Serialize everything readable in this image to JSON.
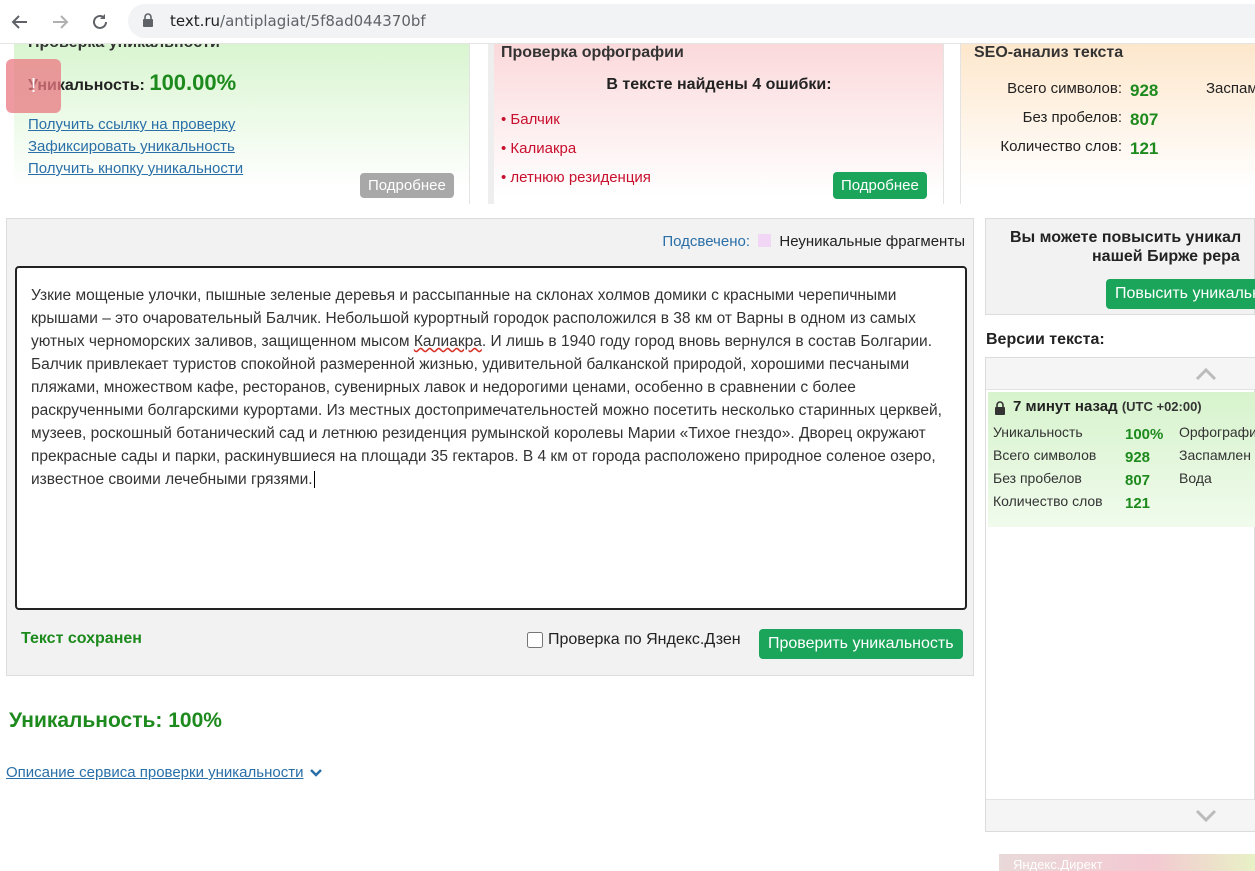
{
  "browser": {
    "url_host": "text.ru",
    "url_path": "/antiplagiat/5f8ad044370bf"
  },
  "uniqueness_panel": {
    "title": "Проверка уникальности",
    "label": "Уникальность:",
    "value": "100.00%",
    "links": [
      "Получить ссылку на проверку",
      "Зафиксировать уникальность",
      "Получить кнопку уникальности"
    ],
    "more_button": "Подробнее",
    "badge_glyph": "!"
  },
  "spelling_panel": {
    "title": "Проверка орфографии",
    "subtitle": "В тексте найдены 4 ошибки:",
    "errors": [
      "Балчик",
      "Калиакра",
      "летнюю резиденция"
    ],
    "more_button": "Подробнее"
  },
  "seo_panel": {
    "title": "SEO-анализ текста",
    "rows": [
      {
        "label": "Всего символов:",
        "value": "928"
      },
      {
        "label": "Без пробелов:",
        "value": "807"
      },
      {
        "label": "Количество слов:",
        "value": "121"
      }
    ],
    "cut_label": "Заспам"
  },
  "editor": {
    "highlight_label": "Подсвечено:",
    "highlight_desc": "Неуникальные фрагменты",
    "text_before": "Узкие мощеные улочки, пышные зеленые деревья и рассыпанные на склонах холмов домики с красными черепичными крышами – это очаровательный Балчик. Небольшой курортный городок расположился в 38 км от Варны в одном из самых уютных черноморских заливов, защищенном мысом ",
    "text_underlined": "Калиакра",
    "text_after": ". И лишь в 1940 году город вновь вернулся в состав Болгарии. Балчик привлекает туристов спокойной размеренной жизнью, удивительной балканской природой, хорошими песчаными пляжами, множеством кафе, ресторанов, сувенирных лавок и недорогими ценами, особенно в сравнении с более раскрученными болгарскими курортами. Из местных достопримечательностей можно посетить несколько старинных церквей, музеев, роскошный ботанический сад и летнюю резиденция румынской королевы Марии «Тихое гнездо». Дворец окружают прекрасные сады и парки, раскинувшиеся на площади 35 гектаров. В 4 км от города расположено природное соленое озеро, известное своими лечебными грязями.",
    "saved_status": "Текст сохранен",
    "zen_checkbox_label": "Проверка по Яндекс.Дзен",
    "zen_checked": false,
    "check_button": "Проверить уникальность"
  },
  "result": {
    "uniqueness_text": "Уникальность: 100%",
    "description_link": "Описание сервиса проверки уникальности"
  },
  "boost_panel": {
    "line1": "Вы можете повысить уникал",
    "line2": "нашей Бирже рера",
    "button": "Повысить уникальн"
  },
  "versions": {
    "title": "Версии текста:",
    "time": "7 минут назад",
    "tz": "(UTC +02:00)",
    "rows": [
      {
        "label": "Уникальность",
        "value": "100%",
        "extra": "Орфографи"
      },
      {
        "label": "Всего символов",
        "value": "928",
        "extra": "Заспамлен"
      },
      {
        "label": "Без пробелов",
        "value": "807",
        "extra": "Вода"
      },
      {
        "label": "Количество слов",
        "value": "121",
        "extra": ""
      }
    ]
  },
  "ad": {
    "label": "Яндекс.Директ"
  },
  "colors": {
    "green": "#1aa55a",
    "value_green": "#1d8a1d",
    "link_blue": "#2a6fa8",
    "error_red": "#c8102e",
    "highlight_swatch": "#f1d6f5"
  }
}
